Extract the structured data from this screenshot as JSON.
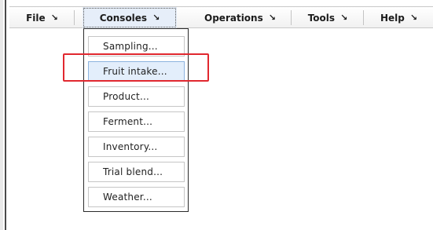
{
  "menubar": {
    "menus": [
      {
        "label": "File",
        "arrow": "↘"
      },
      {
        "label": "Consoles",
        "arrow": "↘"
      },
      {
        "label": "Operations",
        "arrow": "↘"
      },
      {
        "label": "Tools",
        "arrow": "↘"
      },
      {
        "label": "Help",
        "arrow": "↘"
      }
    ],
    "active_menu": "Consoles"
  },
  "dropdown": {
    "items": [
      {
        "label": "Sampling..."
      },
      {
        "label": "Fruit intake..."
      },
      {
        "label": "Product..."
      },
      {
        "label": "Ferment..."
      },
      {
        "label": "Inventory..."
      },
      {
        "label": "Trial blend..."
      },
      {
        "label": "Weather..."
      }
    ],
    "highlighted_item": "Fruit intake..."
  },
  "colors": {
    "callout_border": "#e1282f",
    "highlight_bg": "#e3eefb",
    "highlight_border": "#8db3df"
  }
}
